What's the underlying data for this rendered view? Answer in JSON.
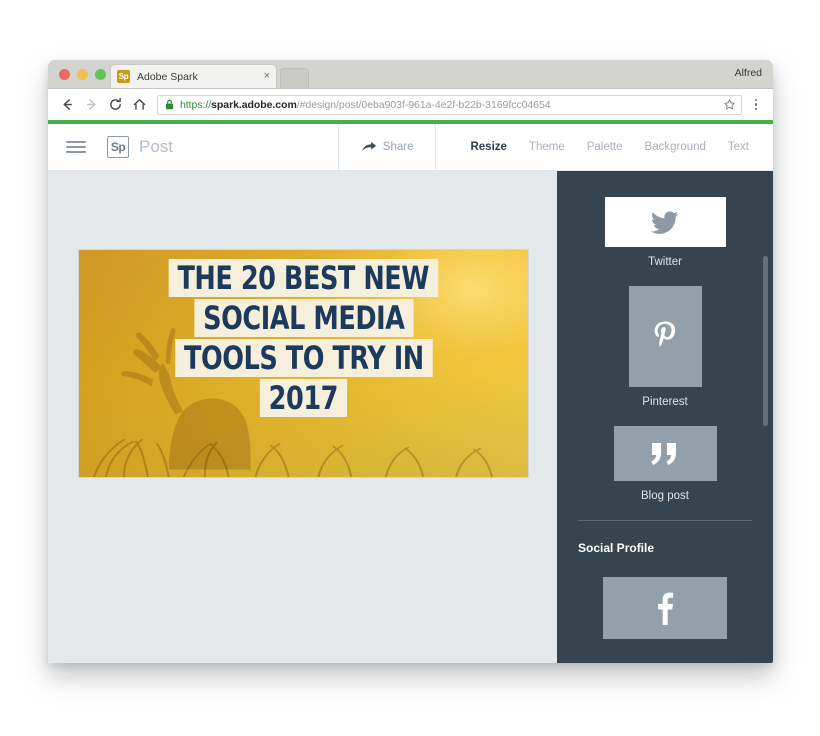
{
  "browser": {
    "tab": {
      "title": "Adobe Spark",
      "favicon_text": "Sp",
      "close_glyph": "×"
    },
    "profile": "Alfred",
    "url": {
      "scheme": "https://",
      "host": "spark.adobe.com",
      "path": "/#design/post/0eba903f-961a-4e2f-b22b-3169fcc04654",
      "full": "https://spark.adobe.com/#design/post/0eba903f-961a-4e2f-b22b-3169fcc04654"
    },
    "nav": {
      "back": "back-arrow",
      "forward": "forward-arrow",
      "reload": "reload-icon",
      "home": "home-icon",
      "bookmark": "star-icon",
      "menu": "kebab-menu-icon"
    }
  },
  "app": {
    "accent_color": "#39b54a",
    "logo_text": "Sp",
    "doc_type": "Post",
    "share_label": "Share",
    "menu": [
      {
        "label": "Resize",
        "active": true
      },
      {
        "label": "Theme",
        "active": false
      },
      {
        "label": "Palette",
        "active": false
      },
      {
        "label": "Background",
        "active": false
      },
      {
        "label": "Text",
        "active": false
      }
    ]
  },
  "canvas": {
    "headline_lines": [
      "THE 20 BEST NEW",
      "SOCIAL MEDIA",
      "TOOLS TO TRY IN",
      "2017"
    ],
    "text_color": "#1b3a5c",
    "highlight_color": "#f6efdc",
    "background_colors": [
      "#c98f1c",
      "#f7dc55"
    ]
  },
  "sidebar": {
    "background_color": "#36444f",
    "section_heading": "Social Profile",
    "sizes": [
      {
        "label": "Twitter",
        "icon": "twitter-bird-icon",
        "style": "white"
      },
      {
        "label": "Pinterest",
        "icon": "pinterest-icon",
        "style": "gray"
      },
      {
        "label": "Blog post",
        "icon": "quote-icon",
        "style": "gray"
      }
    ],
    "profile_sizes": [
      {
        "label": "Facebook",
        "icon": "facebook-icon",
        "style": "gray"
      }
    ]
  }
}
